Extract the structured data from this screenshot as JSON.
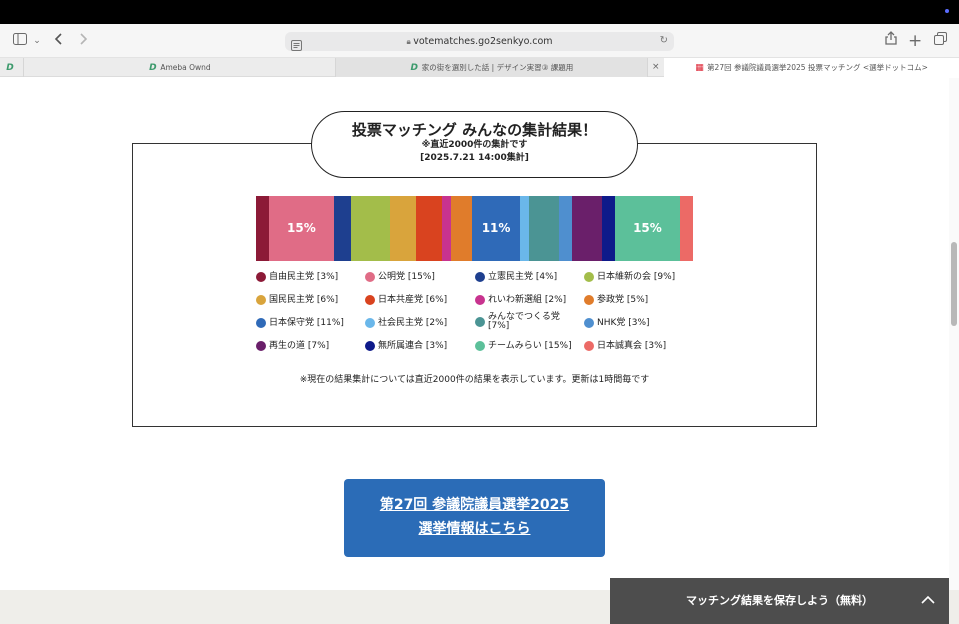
{
  "browser": {
    "url": "votematches.go2senkyo.com",
    "tabs": [
      {
        "label": "Ameba Ownd",
        "active": false
      },
      {
        "label": "家の街を選別した話 | デザイン実習③ 課題用",
        "active": true
      },
      {
        "label": "第27回 参議院議員選挙2025 投票マッチング <選挙ドットコム>",
        "active": false
      }
    ],
    "tab_close": "×"
  },
  "panel": {
    "title": "投票マッチング みんなの集計結果！",
    "subtitle": "※直近2000件の集計です",
    "timestamp": "[2025.7.21 14:00集計]",
    "note": "※現在の結果集計については直近2000件の結果を表示しています。更新は1時間毎です"
  },
  "chart_data": {
    "type": "bar",
    "orientation": "stacked-horizontal",
    "unit": "%",
    "categories": [
      "自由民主党",
      "公明党",
      "立憲民主党",
      "日本維新の会",
      "国民民主党",
      "日本共産党",
      "れいわ新選組",
      "参政党",
      "日本保守党",
      "社会民主党",
      "みんなでつくる党",
      "NHK党",
      "再生の道",
      "無所属連合",
      "チームみらい",
      "日本誠真会"
    ],
    "values": [
      3,
      15,
      4,
      9,
      6,
      6,
      2,
      5,
      11,
      2,
      7,
      3,
      7,
      3,
      15,
      3
    ],
    "legend_labels": [
      "自由民主党 [3%]",
      "公明党 [15%]",
      "立憲民主党 [4%]",
      "日本維新の会 [9%]",
      "国民民主党 [6%]",
      "日本共産党 [6%]",
      "れいわ新選組 [2%]",
      "参政党 [5%]",
      "日本保守党 [11%]",
      "社会民主党 [2%]",
      "みんなでつくる党 [7%]",
      "NHK党 [3%]",
      "再生の道 [7%]",
      "無所属連合 [3%]",
      "チームみらい [15%]",
      "日本誠真会 [3%]"
    ],
    "colors": [
      "#8c1a37",
      "#e06c86",
      "#1e3f8f",
      "#a3bd4a",
      "#d9a43c",
      "#d9431f",
      "#c8338f",
      "#e07c2b",
      "#2f6ab8",
      "#6ab7ea",
      "#4b9494",
      "#4f8fcf",
      "#6a1f6a",
      "#0e1a8a",
      "#5cc09a",
      "#ec6a66"
    ],
    "segment_labels": [
      "",
      "15%",
      "",
      "",
      "",
      "",
      "",
      "",
      "11%",
      "",
      "",
      "",
      "",
      "",
      "15%",
      ""
    ],
    "legend_placement": "bottom"
  },
  "cta": {
    "line1": "第27回 参議院議員選挙2025",
    "line2": "選挙情報はこちら"
  },
  "save_bar": {
    "label": "マッチング結果を保存しよう（無料）"
  }
}
